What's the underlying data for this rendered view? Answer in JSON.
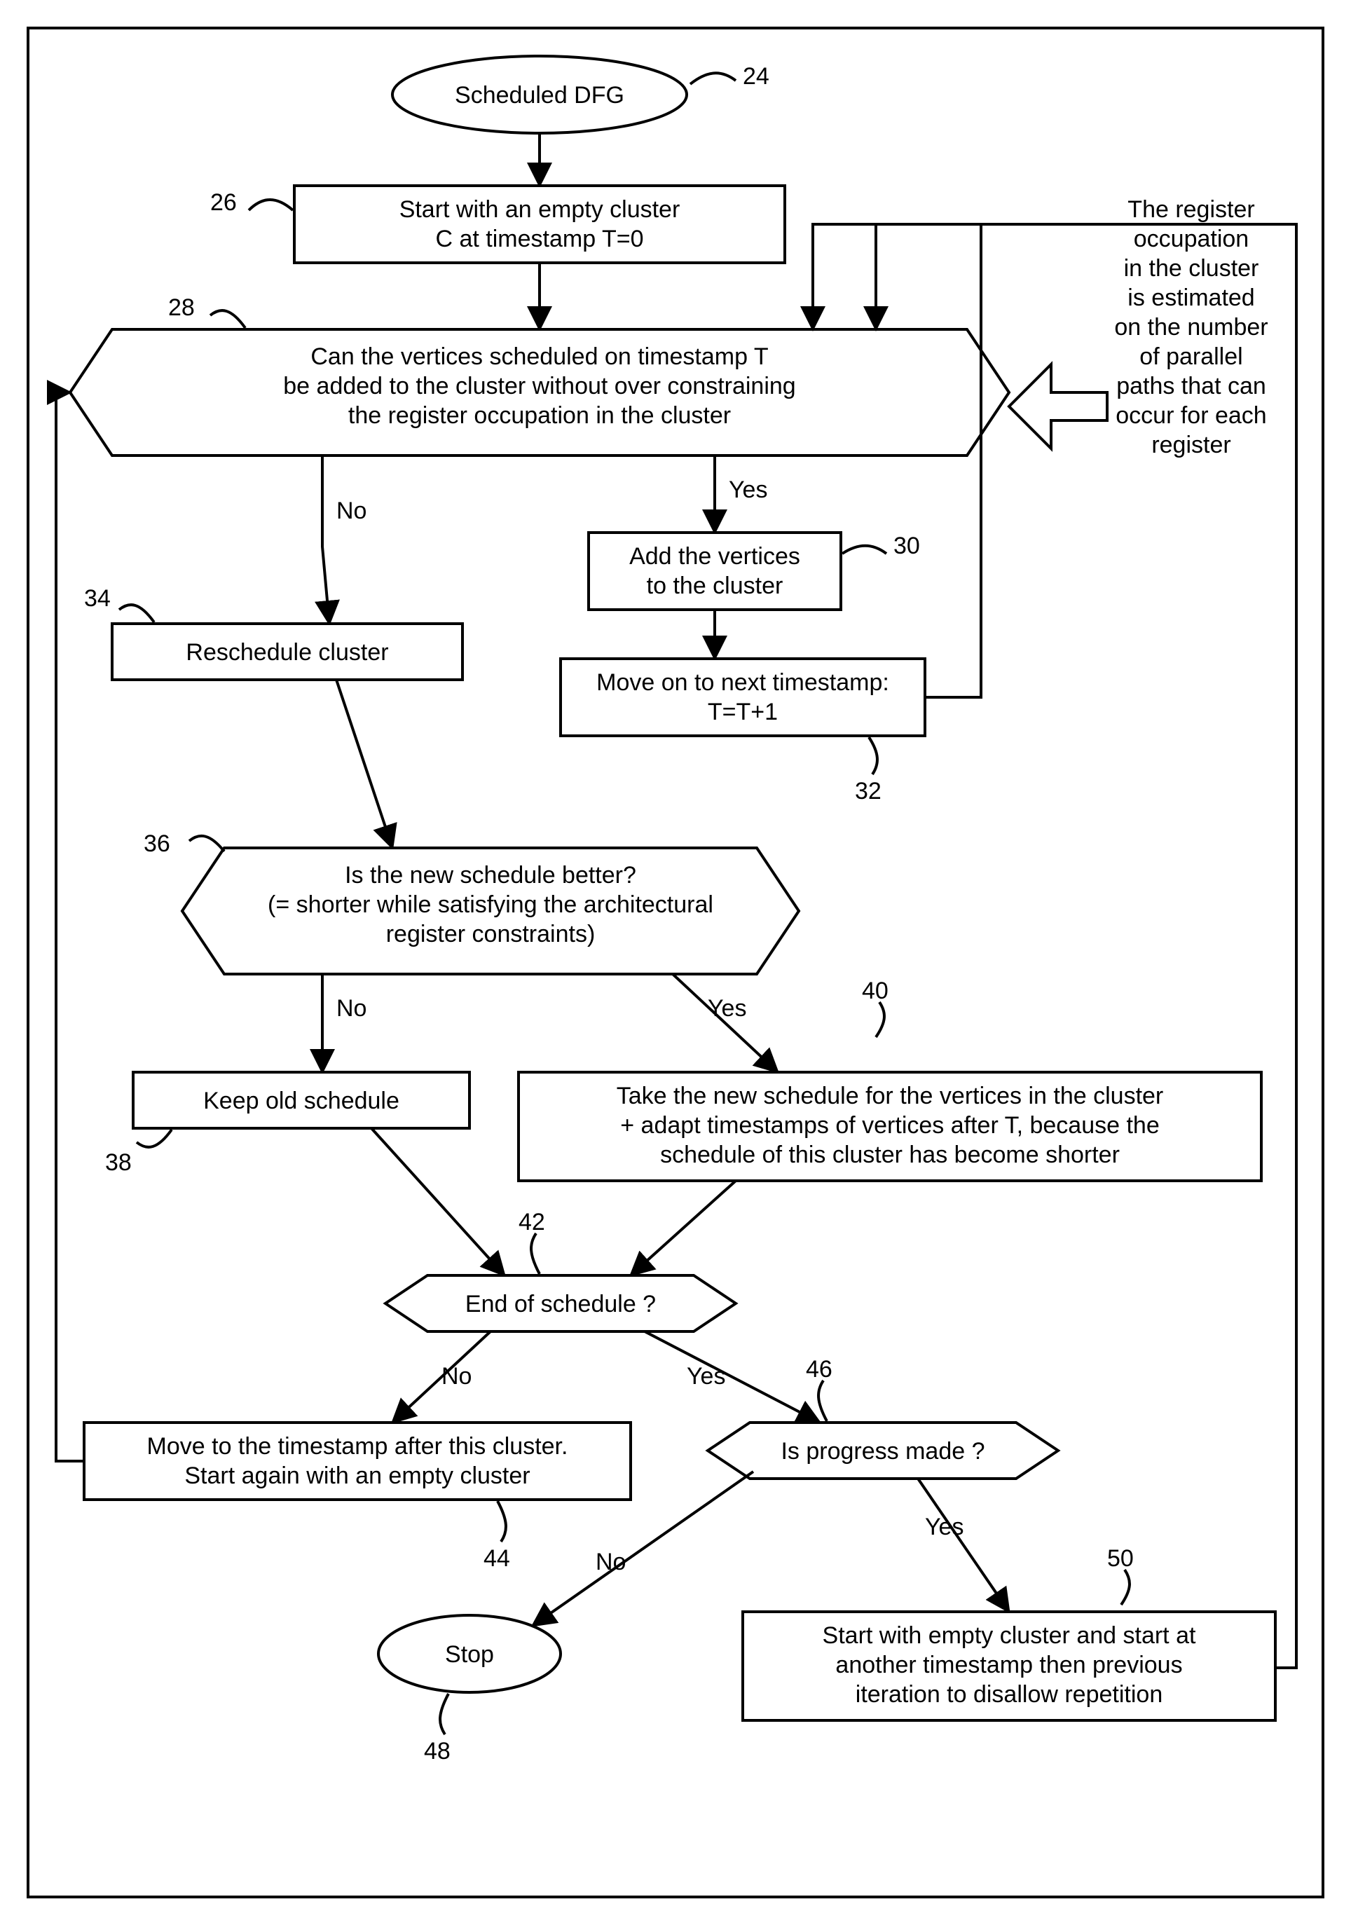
{
  "chart_data": {
    "type": "flowchart",
    "nodes": [
      {
        "id": "24",
        "kind": "terminator",
        "text": "Scheduled DFG"
      },
      {
        "id": "26",
        "kind": "process",
        "text": "Start with an empty cluster C at timestamp T=0"
      },
      {
        "id": "28",
        "kind": "decision",
        "text": "Can the vertices scheduled on timestamp T be added to the cluster without over constraining the register occupation in the cluster"
      },
      {
        "id": "30",
        "kind": "process",
        "text": "Add the vertices to the cluster"
      },
      {
        "id": "32",
        "kind": "process",
        "text": "Move on to next timestamp: T=T+1"
      },
      {
        "id": "34",
        "kind": "process",
        "text": "Reschedule cluster"
      },
      {
        "id": "36",
        "kind": "decision",
        "text": "Is the new schedule better? (= shorter while satisfying the architectural register constraints)"
      },
      {
        "id": "38",
        "kind": "process",
        "text": "Keep old schedule"
      },
      {
        "id": "40",
        "kind": "process",
        "text": "Take the new schedule for the vertices in the cluster + adapt timestamps of vertices after T, because the schedule of this cluster has become shorter"
      },
      {
        "id": "42",
        "kind": "decision",
        "text": "End of schedule ?"
      },
      {
        "id": "44",
        "kind": "process",
        "text": "Move to the timestamp after this cluster. Start again with an empty cluster"
      },
      {
        "id": "46",
        "kind": "decision",
        "text": "Is progress made ?"
      },
      {
        "id": "48",
        "kind": "terminator",
        "text": "Stop"
      },
      {
        "id": "50",
        "kind": "process",
        "text": "Start with empty cluster and start at another timestamp then previous iteration to disallow repetition"
      }
    ],
    "annotation": "The register occupation in the cluster is estimated on the number of parallel paths that can occur for each register",
    "edges": [
      {
        "from": "24",
        "to": "26",
        "label": null
      },
      {
        "from": "26",
        "to": "28",
        "label": null
      },
      {
        "from": "28",
        "to": "30",
        "label": "Yes"
      },
      {
        "from": "28",
        "to": "34",
        "label": "No"
      },
      {
        "from": "30",
        "to": "32",
        "label": null
      },
      {
        "from": "32",
        "to": "28",
        "label": null
      },
      {
        "from": "34",
        "to": "36",
        "label": null
      },
      {
        "from": "36",
        "to": "38",
        "label": "No"
      },
      {
        "from": "36",
        "to": "40",
        "label": "Yes"
      },
      {
        "from": "38",
        "to": "42",
        "label": null
      },
      {
        "from": "40",
        "to": "42",
        "label": null
      },
      {
        "from": "42",
        "to": "44",
        "label": "No"
      },
      {
        "from": "42",
        "to": "46",
        "label": "Yes"
      },
      {
        "from": "44",
        "to": "28",
        "label": null
      },
      {
        "from": "46",
        "to": "48",
        "label": "No"
      },
      {
        "from": "46",
        "to": "50",
        "label": "Yes"
      },
      {
        "from": "50",
        "to": "28",
        "label": null
      },
      {
        "from": "annotation",
        "to": "28",
        "label": null
      }
    ]
  },
  "labels": {
    "yes": "Yes",
    "no": "No"
  },
  "nodes": {
    "n24": {
      "ref": "24",
      "text": "Scheduled DFG"
    },
    "n26": {
      "ref": "26",
      "l1": "Start with an empty cluster",
      "l2": "C at timestamp T=0"
    },
    "n28": {
      "ref": "28",
      "l1": "Can the vertices scheduled on timestamp T",
      "l2": "be added to the cluster without over constraining",
      "l3": "the register occupation in the cluster"
    },
    "n30": {
      "ref": "30",
      "l1": "Add the vertices",
      "l2": "to the cluster"
    },
    "n32": {
      "ref": "32",
      "l1": "Move on to next timestamp:",
      "l2": "T=T+1"
    },
    "n34": {
      "ref": "34",
      "text": "Reschedule cluster"
    },
    "n36": {
      "ref": "36",
      "l1": "Is the new schedule better?",
      "l2": "(= shorter while satisfying the architectural",
      "l3": "register constraints)"
    },
    "n38": {
      "ref": "38",
      "text": "Keep old schedule"
    },
    "n40": {
      "ref": "40",
      "l1": "Take the new schedule for the vertices in the cluster",
      "l2": "+ adapt timestamps of vertices after T, because the",
      "l3": "schedule of this cluster has become shorter"
    },
    "n42": {
      "ref": "42",
      "text": "End of schedule ?"
    },
    "n44": {
      "ref": "44",
      "l1": "Move to the timestamp after this cluster.",
      "l2": "Start again with an empty cluster"
    },
    "n46": {
      "ref": "46",
      "text": "Is progress made ?"
    },
    "n48": {
      "ref": "48",
      "text": "Stop"
    },
    "n50": {
      "ref": "50",
      "l1": "Start with empty cluster and start at",
      "l2": "another timestamp then previous",
      "l3": "iteration to disallow repetition"
    },
    "ann": {
      "l1": "The register",
      "l2": "occupation",
      "l3": "in the cluster",
      "l4": "is estimated",
      "l5": "on the number",
      "l6": "of parallel",
      "l7": "paths that can",
      "l8": "occur for each",
      "l9": "register"
    }
  }
}
